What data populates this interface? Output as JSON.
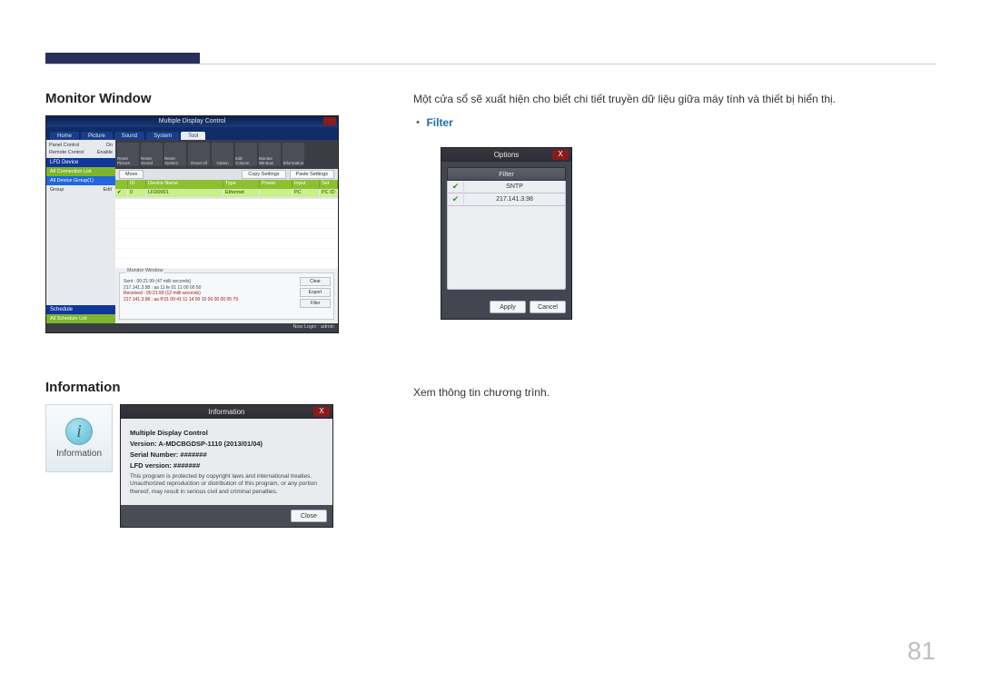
{
  "page_number": "81",
  "section1": {
    "heading": "Monitor Window",
    "description": "Một cửa sổ sẽ xuất hiện cho biết chi tiết truyền dữ liệu giữa máy tính và thiết bị hiển thị.",
    "filter_label": "Filter"
  },
  "mdc": {
    "title": "Multiple Display Control",
    "tabs": [
      "Home",
      "Picture",
      "Sound",
      "System",
      "Tool"
    ],
    "active_tab_index": 4,
    "side_options": {
      "panel_control_label": "Panel Control",
      "panel_control_value": "On",
      "remote_control_label": "Remote Control",
      "remote_control_value": "Enable"
    },
    "toolbar": [
      "Reset Picture",
      "Reset Sound",
      "Reset System",
      "Reset All",
      "Option",
      "Edit Column",
      "Monitor Window",
      "Information"
    ],
    "sub_toolbar": {
      "move": "Move",
      "copy": "Copy Settings",
      "paste": "Paste Settings"
    },
    "side_sections": {
      "lfd_device": "LFD Device",
      "all_conn": "All Connection List",
      "device_group": "All Device Group(1)",
      "group_label": "Group",
      "edit_label": "Edit",
      "schedule": "Schedule",
      "all_schedule": "All Schedule List"
    },
    "table": {
      "headers": {
        "id": "ID",
        "name": "Device Name",
        "type": "Type",
        "power": "Power",
        "input": "Input",
        "setting": "Set"
      },
      "row": {
        "id": "0",
        "name": "LFD0001",
        "type": "Ethernet",
        "power": "",
        "input": "PC",
        "setting": "PC ID"
      }
    },
    "monitor_box": {
      "title": "Monitor Window",
      "sent_line": "Sent : 00:21:99 (47 milli seconds)",
      "ip_line": "217.141.3.98 : aa 11 fe 01 11 00 00 50",
      "recv_line": "Received : 00:21:99 (12 milli seconds)",
      "recv_data": "217.141.3.98 : aa ff 01 09 41 11 14 00 10 00 00 00 05 79",
      "buttons": {
        "clear": "Clear",
        "export": "Export",
        "filter": "Filter"
      }
    },
    "footer": "Now Login : admin"
  },
  "filter_dialog": {
    "title": "Options",
    "header": "Filter",
    "rows": [
      "SNTP",
      "217.141.3.98"
    ],
    "apply": "Apply",
    "cancel": "Cancel"
  },
  "section2": {
    "heading": "Information",
    "description": "Xem thông tin chương trình.",
    "icon_label": "Information"
  },
  "info_dialog": {
    "title": "Information",
    "program": "Multiple Display Control",
    "version_label": "Version: A-MDCBGDSP-1110 (2013/01/04)",
    "serial_label": "Serial Number: #######",
    "lfd_label": "LFD version: #######",
    "legal": "This program is protected by copyright laws and international treaties. Unauthorized reproduction or distribution of this program, or any portion thereof, may result in serious civil and criminal penalties.",
    "close": "Close"
  }
}
